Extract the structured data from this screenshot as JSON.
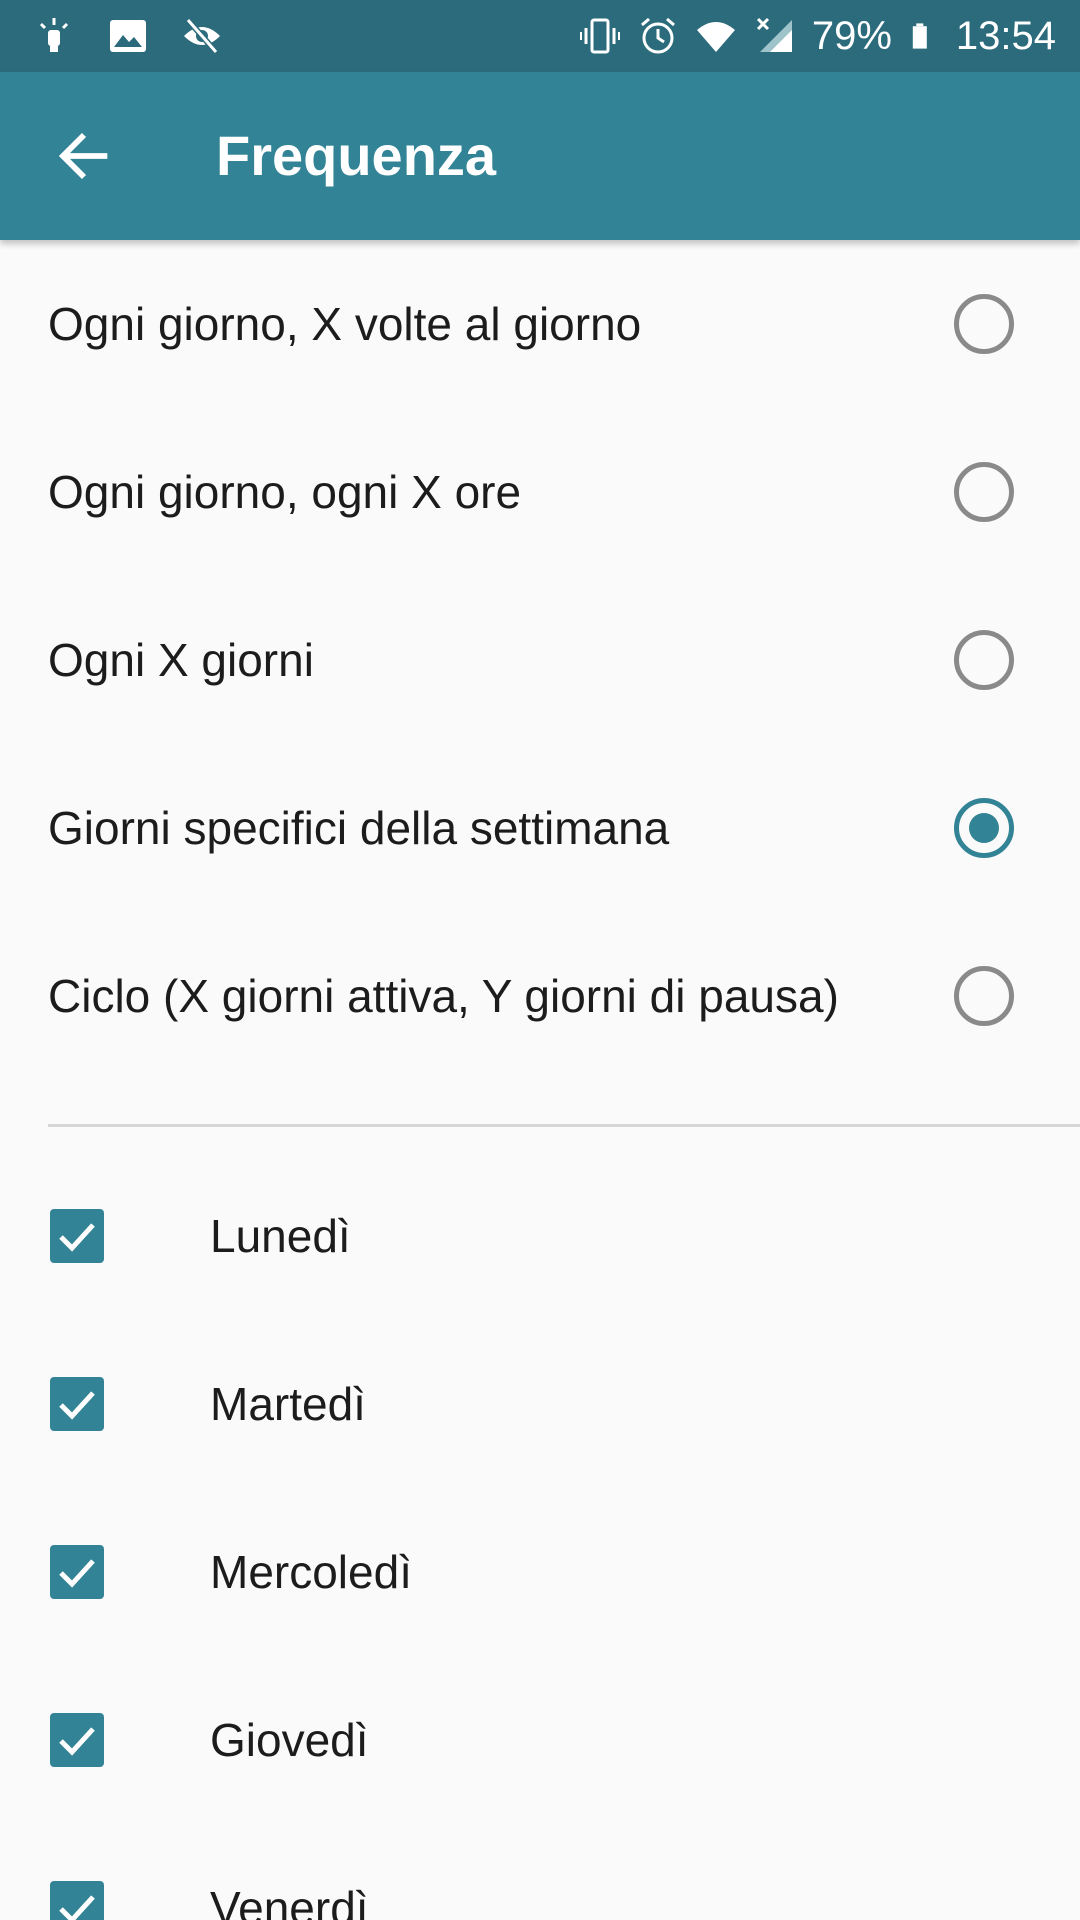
{
  "status_bar": {
    "left_icons": [
      "light-bulb-icon",
      "image-icon",
      "eye-off-icon"
    ],
    "right_icons": [
      "vibrate-icon",
      "alarm-icon",
      "wifi-icon",
      "signal-icon",
      "battery-icon"
    ],
    "battery": "79%",
    "time": "13:54",
    "background_color": "#2b6b7c"
  },
  "app_bar": {
    "title": "Frequenza",
    "back_icon": "arrow-back-icon",
    "color": "#318395"
  },
  "options": [
    {
      "label": "Ogni giorno, X volte al giorno",
      "selected": false
    },
    {
      "label": "Ogni giorno, ogni X ore",
      "selected": false
    },
    {
      "label": "Ogni X giorni",
      "selected": false
    },
    {
      "label": "Giorni specifici della settimana",
      "selected": true
    },
    {
      "label": "Ciclo (X giorni attiva, Y giorni di pausa)",
      "selected": false
    }
  ],
  "days": [
    {
      "label": "Lunedì",
      "checked": true
    },
    {
      "label": "Martedì",
      "checked": true
    },
    {
      "label": "Mercoledì",
      "checked": true
    },
    {
      "label": "Giovedì",
      "checked": true
    },
    {
      "label": "Venerdì",
      "checked": true
    }
  ],
  "accent_color": "#318395"
}
